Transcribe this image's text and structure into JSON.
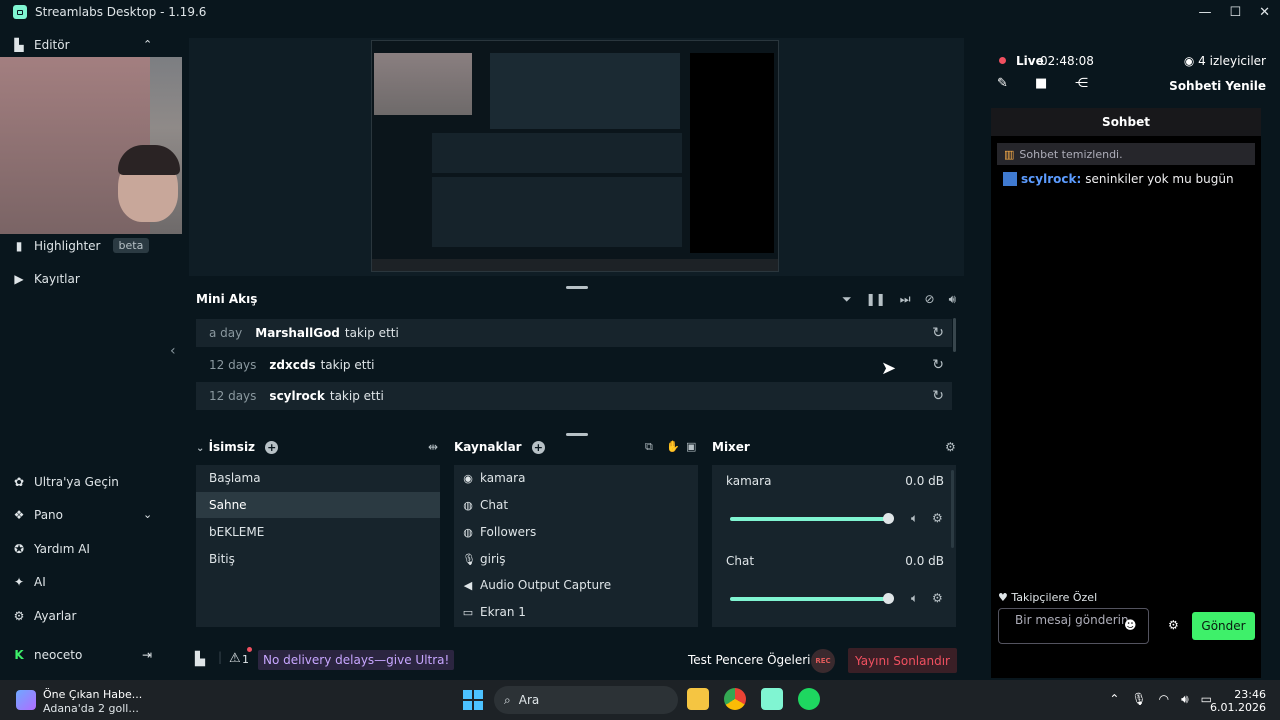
{
  "window": {
    "title": "Streamlabs Desktop - 1.19.6",
    "minimize": "—",
    "maximize": "☐",
    "close": "✕"
  },
  "sidebar": {
    "editor": "Editör",
    "highlighter": "Highlighter",
    "highlighter_badge": "beta",
    "recordings": "Kayıtlar",
    "ultra": "Ultra'ya Geçin",
    "dashboard": "Pano",
    "help_ai": "Yardım AI",
    "ai": "AI",
    "settings": "Ayarlar",
    "user": "neoceto"
  },
  "feed": {
    "title": "Mini Akış",
    "rows": [
      {
        "time": "a day",
        "user": "MarshallGod",
        "action": "takip etti"
      },
      {
        "time": "12 days",
        "user": "zdxcds",
        "action": "takip etti"
      },
      {
        "time": "12 days",
        "user": "scylrock",
        "action": "takip etti"
      }
    ]
  },
  "scenes": {
    "title": "İsimsiz",
    "items": [
      "Başlama",
      "Sahne",
      "bEKLEME",
      "Bitiş"
    ],
    "selected_index": 1
  },
  "sources": {
    "title": "Kaynaklar",
    "items": [
      {
        "icon": "camera-icon",
        "label": "kamara"
      },
      {
        "icon": "globe-icon",
        "label": "Chat"
      },
      {
        "icon": "globe-icon",
        "label": "Followers"
      },
      {
        "icon": "microphone-icon",
        "label": "giriş"
      },
      {
        "icon": "speaker-icon",
        "label": "Audio Output Capture"
      },
      {
        "icon": "monitor-icon",
        "label": "Ekran 1"
      }
    ]
  },
  "mixer": {
    "title": "Mixer",
    "channels": [
      {
        "name": "kamara",
        "db": "0.0 dB",
        "level": 1.0
      },
      {
        "name": "Chat",
        "db": "0.0 dB",
        "level": 1.0
      }
    ]
  },
  "footer": {
    "alerts_count": "1",
    "ultra_promo": "No delivery delays—give Ultra!",
    "test_windows": "Test Pencere Ögeleri",
    "rec": "REC",
    "end_stream": "Yayını Sonlandır"
  },
  "stream": {
    "live_label": "Live",
    "live_time": "02:48:08",
    "viewers": "4 izleyiciler",
    "refresh_chat": "Sohbeti Yenile"
  },
  "chat": {
    "header": "Sohbet",
    "cleared": "Sohbet temizlendi.",
    "message_user": "scylrock:",
    "message_text": "seninkiler yok mu bugün",
    "followers_only": "Takipçilere Özel",
    "input_placeholder": "Bir mesaj gönderin",
    "send": "Gönder"
  },
  "taskbar": {
    "news_title": "Öne Çıkan Habe...",
    "news_sub": "Adana'da 2 goll...",
    "search": "Ara",
    "time": "23:46",
    "date": "6.01.2026"
  },
  "colors": {
    "accent": "#80f5d2",
    "live": "#f05060",
    "send": "#3ef06a",
    "promo": "#c7a6ff"
  }
}
